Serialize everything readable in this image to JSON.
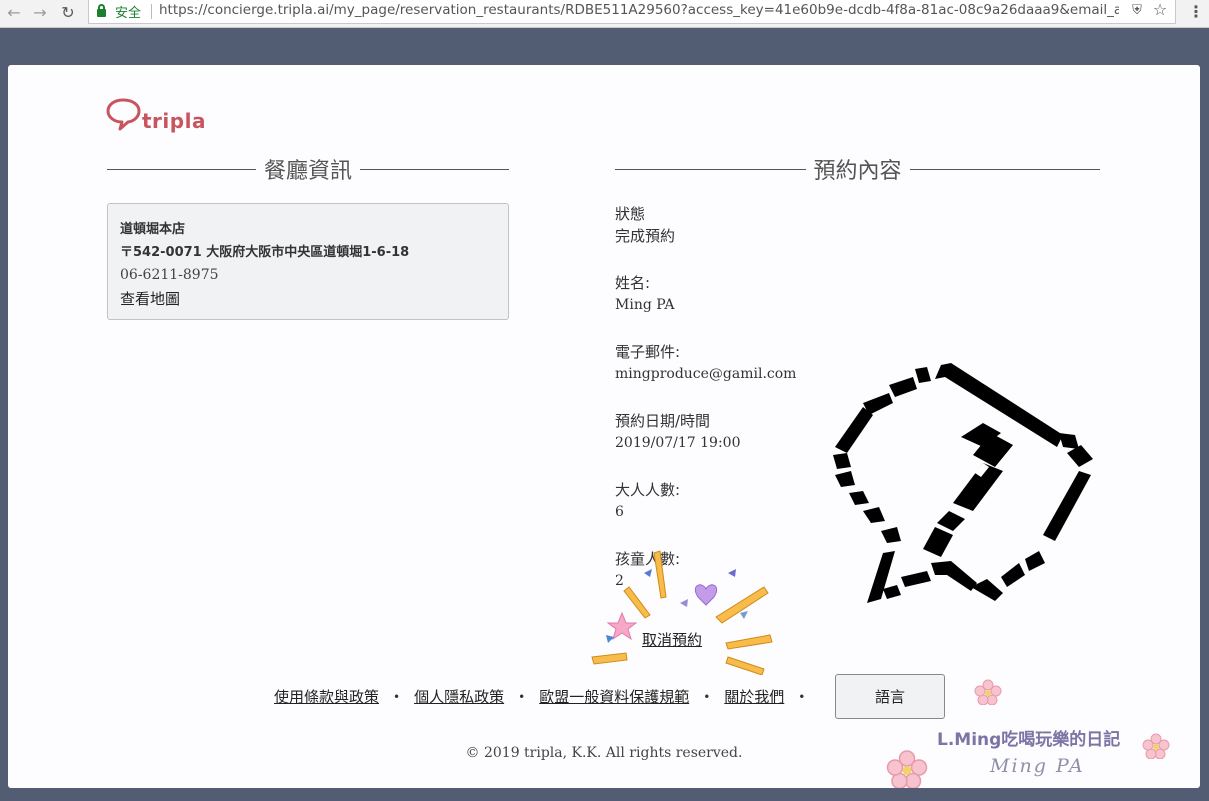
{
  "browser": {
    "secure_label": "安全",
    "url": "https://concierge.tripla.ai/my_page/reservation_restaurants/RDBE511A29560?access_key=41e60b9e-dcdb-4f8a-81ac-08c9a26daaa9&email_ad..."
  },
  "logo": {
    "text": "tripla"
  },
  "restaurant_section": {
    "title": "餐廳資訊",
    "name": "道頓堀本店",
    "address": "〒542-0071 大阪府大阪市中央區道頓堀1-6-18",
    "phone": "06-6211-8975",
    "map_link": "查看地圖"
  },
  "reservation_section": {
    "title": "預約內容",
    "items": [
      {
        "label": "狀態",
        "value": "完成預約"
      },
      {
        "label": "姓名:",
        "value": "Ming PA"
      },
      {
        "label": "電子郵件:",
        "value": "mingproduce@gamil.com"
      },
      {
        "label": "預約日期/時間",
        "value": "2019/07/17 19:00"
      },
      {
        "label": "大人人數:",
        "value": "6"
      },
      {
        "label": "孩童人數:",
        "value": "2"
      }
    ],
    "cancel_link": "取消預約"
  },
  "footer": {
    "links": [
      "使用條款與政策",
      "個人隱私政策",
      "歐盟一般資料保護規範",
      "關於我們"
    ],
    "language_button": "語言",
    "copyright": "© 2019 tripla, K.K. All rights reserved."
  },
  "watermark": {
    "line1": "L.Ming吃喝玩樂的日記",
    "line2": "Ming PA"
  },
  "colors": {
    "brand": "#c8555d",
    "backdrop": "#525c72",
    "secure": "#1a7f2e"
  }
}
